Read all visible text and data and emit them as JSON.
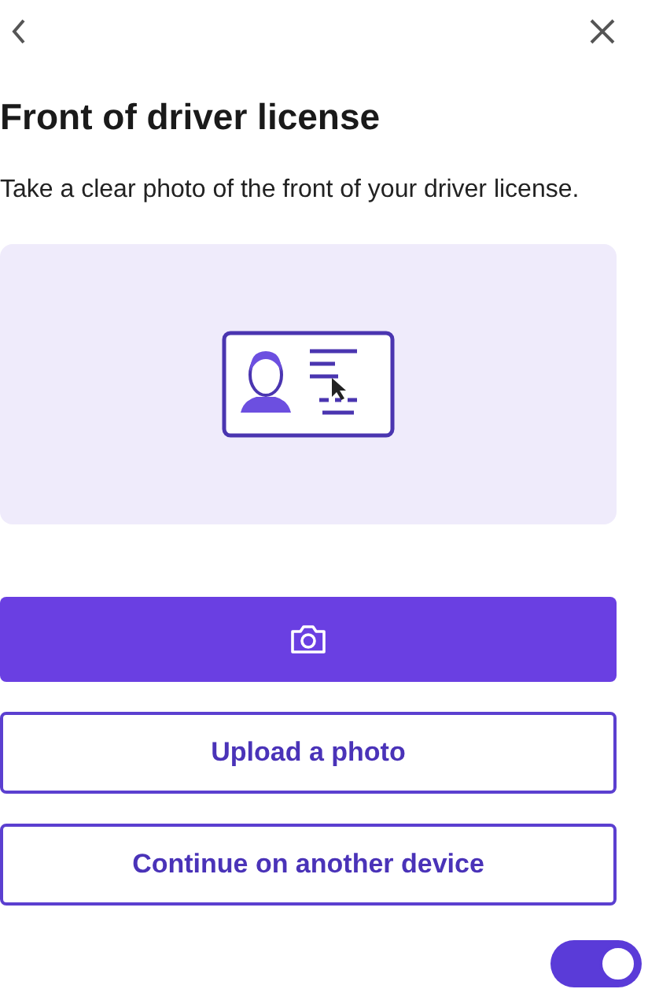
{
  "title": "Front of driver license",
  "description": "Take a clear photo of the front of your driver license.",
  "buttons": [
    {
      "kind": "camera"
    },
    {
      "kind": "outline",
      "label": "Upload a photo"
    },
    {
      "kind": "outline",
      "label": "Continue on another device"
    }
  ],
  "toggle": {
    "on": true
  }
}
